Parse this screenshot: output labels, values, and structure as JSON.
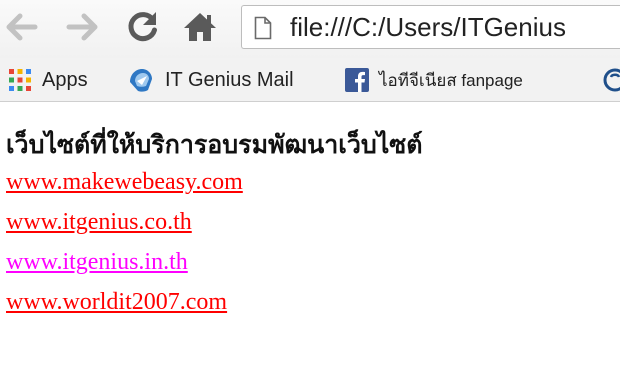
{
  "browser": {
    "address_bar": {
      "url": "file:///C:/Users/ITGenius"
    },
    "bookmarks": [
      {
        "label": "Apps",
        "icon": "apps-grid-icon"
      },
      {
        "label": "IT Genius Mail",
        "icon": "mail-icon"
      },
      {
        "label": "ไอทีจีเนียส fanpage",
        "icon": "facebook-icon"
      },
      {
        "label": "",
        "icon": "bookmark-icon"
      }
    ]
  },
  "page": {
    "heading": "เว็บไซต์ที่ให้บริการอบรมพัฒนาเว็บไซต์",
    "links": [
      {
        "text": "www.makewebeasy.com",
        "color": "#ff0000",
        "visited": false
      },
      {
        "text": "www.itgenius.co.th",
        "color": "#ff0000",
        "visited": false
      },
      {
        "text": "www.itgenius.in.th",
        "color": "#ff00ff",
        "visited": true
      },
      {
        "text": "www.worldit2007.com",
        "color": "#ff0000",
        "visited": false
      }
    ]
  },
  "colors": {
    "link": "#ff0000",
    "visited_link": "#ff00ff",
    "nav_icon": "#5a5a5a",
    "nav_icon_disabled": "#c2c2c2",
    "facebook": "#3b5998"
  }
}
